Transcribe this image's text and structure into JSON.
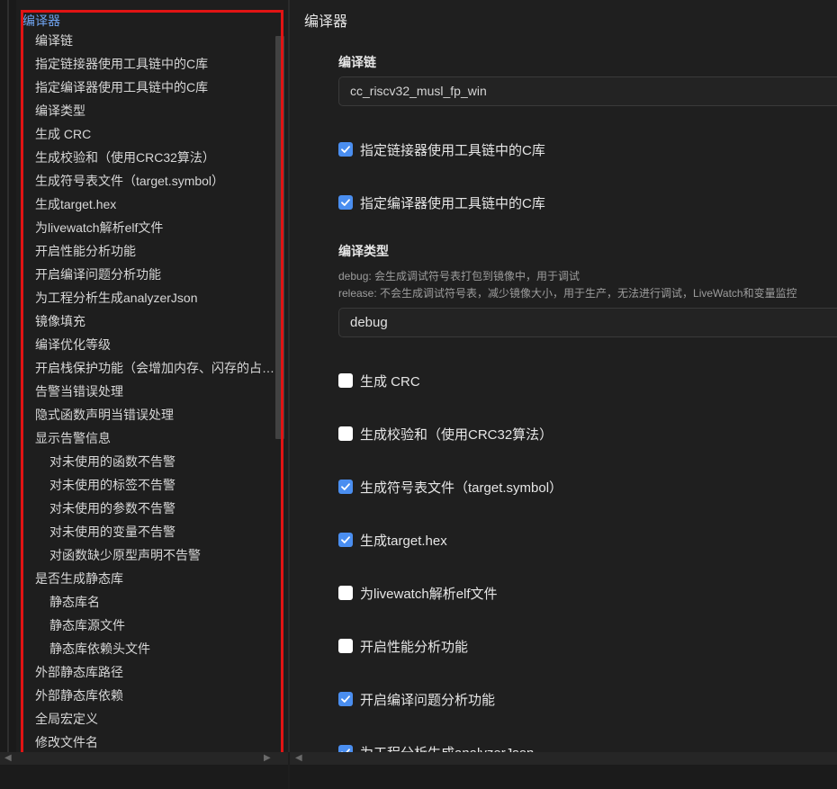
{
  "toc": {
    "items": [
      {
        "label": "编译器",
        "level": 0
      },
      {
        "label": "编译链",
        "level": 1
      },
      {
        "label": "指定链接器使用工具链中的C库",
        "level": 1
      },
      {
        "label": "指定编译器使用工具链中的C库",
        "level": 1
      },
      {
        "label": "编译类型",
        "level": 1
      },
      {
        "label": "生成 CRC",
        "level": 1
      },
      {
        "label": "生成校验和（使用CRC32算法）",
        "level": 1
      },
      {
        "label": "生成符号表文件（target.symbol）",
        "level": 1
      },
      {
        "label": "生成target.hex",
        "level": 1
      },
      {
        "label": "为livewatch解析elf文件",
        "level": 1
      },
      {
        "label": "开启性能分析功能",
        "level": 1
      },
      {
        "label": "开启编译问题分析功能",
        "level": 1
      },
      {
        "label": "为工程分析生成analyzerJson",
        "level": 1
      },
      {
        "label": "镜像填充",
        "level": 1
      },
      {
        "label": "编译优化等级",
        "level": 1
      },
      {
        "label": "开启栈保护功能（会增加内存、闪存的占用，请谨慎使用）",
        "level": 1
      },
      {
        "label": "告警当错误处理",
        "level": 1
      },
      {
        "label": "隐式函数声明当错误处理",
        "level": 1
      },
      {
        "label": "显示告警信息",
        "level": 1
      },
      {
        "label": "对未使用的函数不告警",
        "level": 2
      },
      {
        "label": "对未使用的标签不告警",
        "level": 2
      },
      {
        "label": "对未使用的参数不告警",
        "level": 2
      },
      {
        "label": "对未使用的变量不告警",
        "level": 2
      },
      {
        "label": "对函数缺少原型声明不告警",
        "level": 2
      },
      {
        "label": "是否生成静态库",
        "level": 1
      },
      {
        "label": "静态库名",
        "level": 2
      },
      {
        "label": "静态库源文件",
        "level": 2
      },
      {
        "label": "静态库依赖头文件",
        "level": 2
      },
      {
        "label": "外部静态库路径",
        "level": 1
      },
      {
        "label": "外部静态库依赖",
        "level": 1
      },
      {
        "label": "全局宏定义",
        "level": 1
      },
      {
        "label": "修改文件名",
        "level": 1
      }
    ]
  },
  "main": {
    "section_title": "编译器",
    "toolchain": {
      "label": "编译链",
      "value": "cc_riscv32_musl_fp_win"
    },
    "build_type": {
      "label": "编译类型",
      "desc_debug": "debug: 会生成调试符号表打包到镜像中，用于调试",
      "desc_release": "release: 不会生成调试符号表，减少镜像大小，用于生产，无法进行调试，LiveWatch和变量监控",
      "value": "debug"
    },
    "checks": [
      {
        "label": "指定链接器使用工具链中的C库",
        "checked": true
      },
      {
        "label": "指定编译器使用工具链中的C库",
        "checked": true
      },
      {
        "label": "生成 CRC",
        "checked": false
      },
      {
        "label": "生成校验和（使用CRC32算法）",
        "checked": false
      },
      {
        "label": "生成符号表文件（target.symbol）",
        "checked": true
      },
      {
        "label": "生成target.hex",
        "checked": true
      },
      {
        "label": "为livewatch解析elf文件",
        "checked": false
      },
      {
        "label": "开启性能分析功能",
        "checked": false
      },
      {
        "label": "开启编译问题分析功能",
        "checked": true
      },
      {
        "label": "为工程分析生成analyzerJson",
        "checked": true
      }
    ]
  },
  "colors": {
    "accent": "#4a8ef0",
    "highlight_border": "#e11414",
    "toc_active": "#6fa3ef"
  },
  "icons": {
    "check": "check-icon",
    "scroll_left": "chevron-left-icon",
    "scroll_right": "chevron-right-icon"
  }
}
